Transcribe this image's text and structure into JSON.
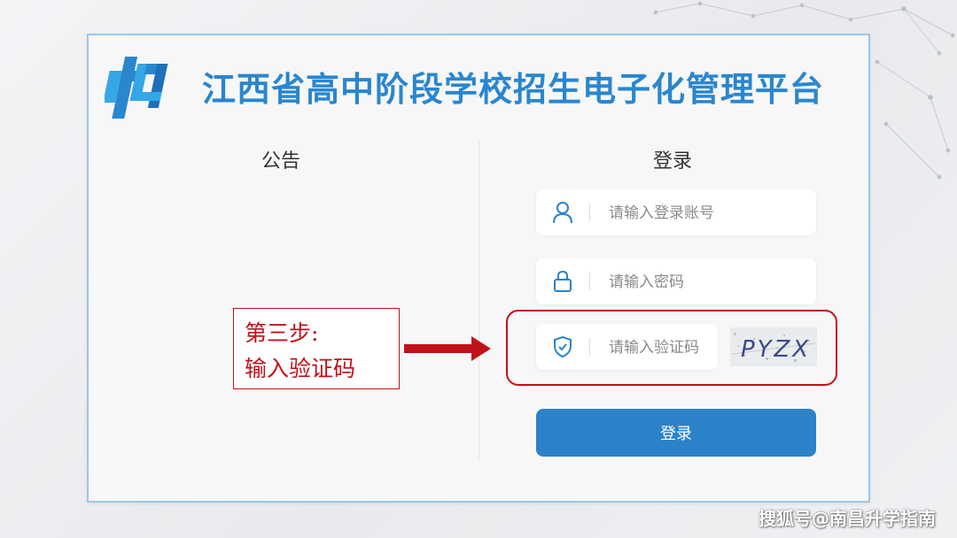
{
  "header": {
    "title": "江西省高中阶段学校招生电子化管理平台",
    "logo_icon": "platform-logo-icon"
  },
  "notice": {
    "title": "公告"
  },
  "login": {
    "title": "登录",
    "account": {
      "placeholder": "请输入登录账号",
      "icon": "user-icon"
    },
    "password": {
      "placeholder": "请输入密码",
      "icon": "lock-icon"
    },
    "captcha": {
      "placeholder": "请输入验证码",
      "icon": "shield-icon",
      "image_text": "PYZX"
    },
    "button_label": "登录"
  },
  "annotation": {
    "line1": "第三步:",
    "line2": "输入验证码",
    "color": "#c0121a"
  },
  "watermark": "搜狐号@南昌升学指南",
  "colors": {
    "brand": "#2a86cf",
    "button": "#2b82c9",
    "border": "#9cc8e6"
  }
}
